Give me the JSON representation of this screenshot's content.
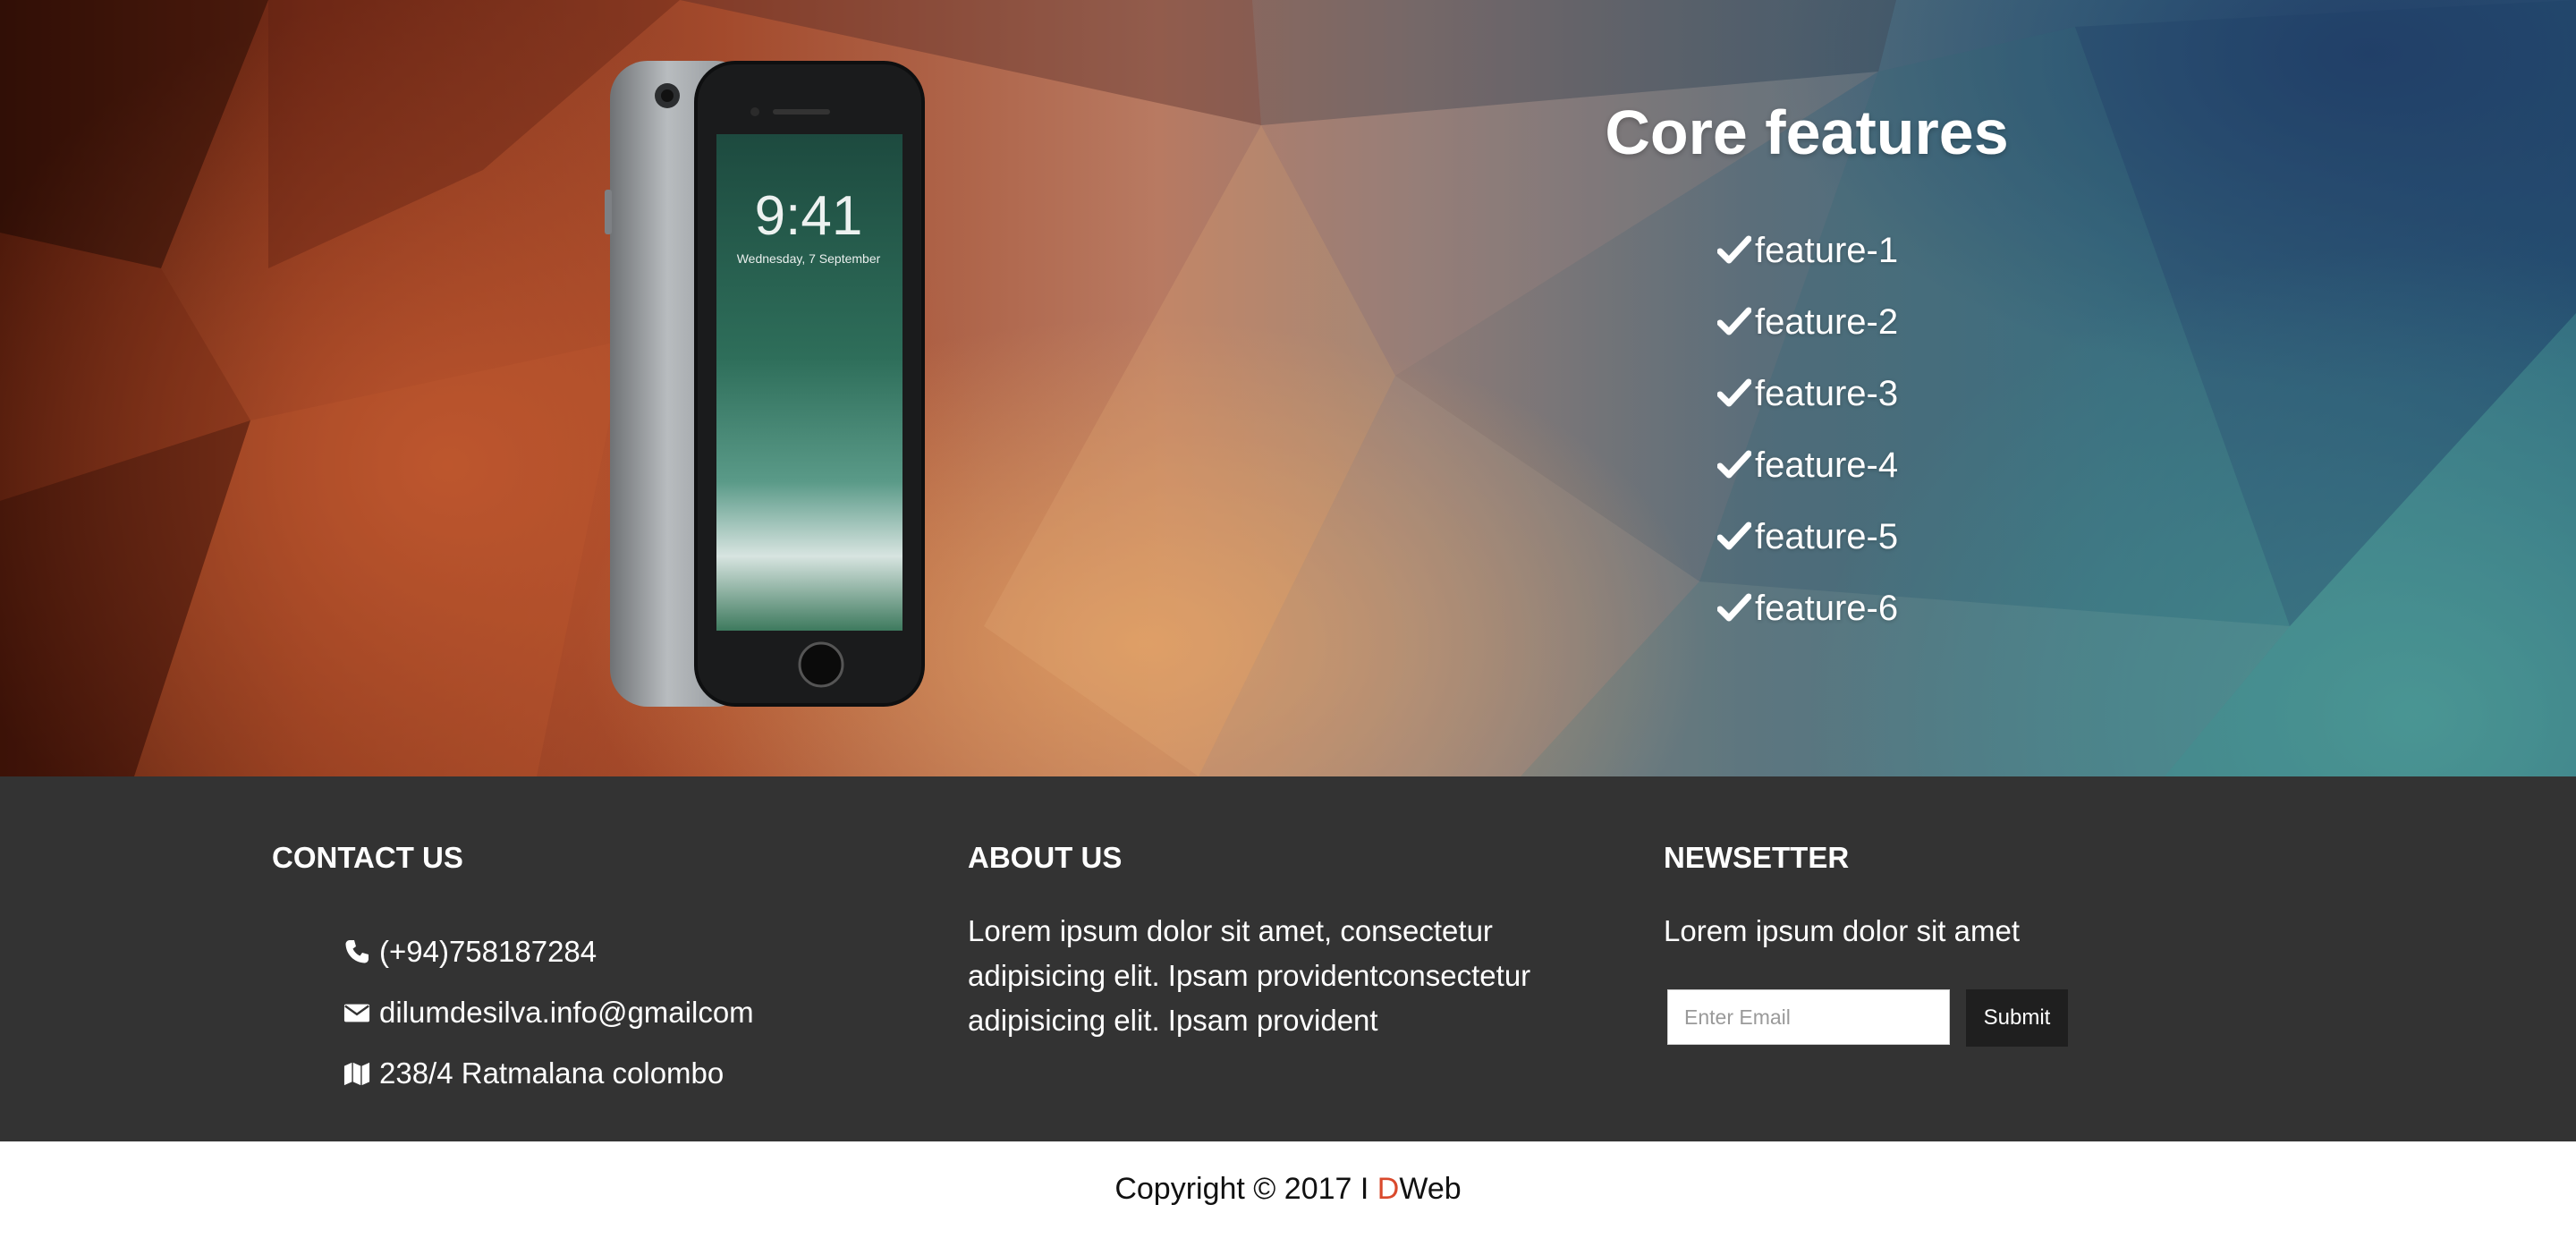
{
  "features": {
    "title": "Core features",
    "items": [
      "feature-1",
      "feature-2",
      "feature-3",
      "feature-4",
      "feature-5",
      "feature-6"
    ]
  },
  "phone": {
    "time": "9:41",
    "date": "Wednesday, 7 September"
  },
  "contact": {
    "heading": "CONTACT US",
    "phone": "(+94)758187284",
    "email": "dilumdesilva.info@gmailcom",
    "address": "238/4 Ratmalana colombo"
  },
  "about": {
    "heading": "ABOUT US",
    "text": "Lorem ipsum dolor sit amet, consectetur adipisicing elit. Ipsam providentconsectetur adipisicing elit. Ipsam provident"
  },
  "newsletter": {
    "heading": "NEWSETTER",
    "text": "Lorem ipsum dolor sit amet",
    "email_placeholder": "Enter Email",
    "submit_label": "Submit"
  },
  "copyright": {
    "prefix": "Copyright © 2017 I ",
    "brand_first": "D",
    "brand_rest": "Web"
  },
  "colors": {
    "footer_bg": "#333333",
    "brand_accent": "#d9492c",
    "submit_bg": "#1f1f1f"
  },
  "icons": {
    "feature": "check-icon",
    "phone": "phone-icon",
    "email": "envelope-icon",
    "address": "map-icon"
  }
}
